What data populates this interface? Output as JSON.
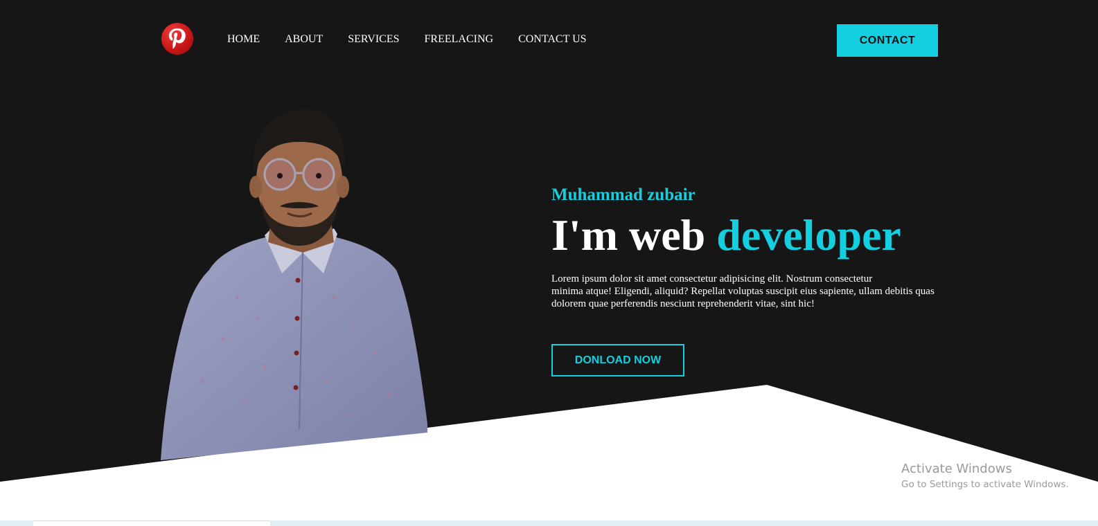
{
  "colors": {
    "accent": "#13cfdf",
    "background": "#161616",
    "text": "#ffffff",
    "logo": "#c81818"
  },
  "header": {
    "logo_icon": "pinterest-logo-icon",
    "nav": [
      {
        "label": "HOME"
      },
      {
        "label": "ABOUT"
      },
      {
        "label": "SERVICES"
      },
      {
        "label": "FREELACING"
      },
      {
        "label": "CONTACT US"
      }
    ],
    "cta_label": "CONTACT"
  },
  "hero": {
    "name": "Muhammad zubair",
    "title_prefix": "I'm web",
    "title_accent": "developer",
    "description_lines": [
      "Lorem ipsum dolor sit amet consectetur adipisicing elit. Nostrum consectetur",
      "minima atque! Eligendi, aliquid? Repellat voluptas suscipit eius sapiente, ullam debitis quas",
      "dolorem quae perferendis nesciunt reprehenderit vitae, sint hic!"
    ],
    "button_label": "DONLOAD NOW"
  },
  "watermark": {
    "title": "Activate Windows",
    "subtitle": "Go to Settings to activate Windows."
  }
}
